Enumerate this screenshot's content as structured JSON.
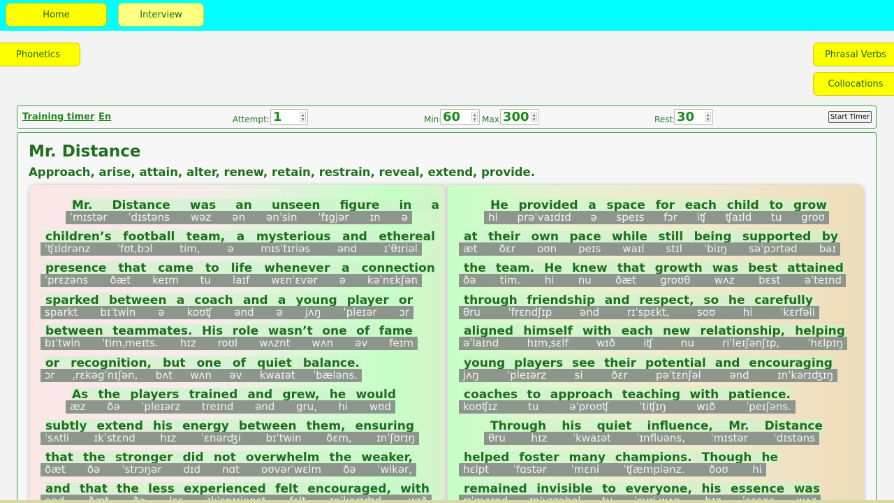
{
  "nav": {
    "home": "Home",
    "interview": "Interview",
    "phonetics": "Phonetics",
    "phrasal_verbs": "Phrasal Verbs",
    "collocations": "Collocations"
  },
  "timer": {
    "training_timer": "Training timer",
    "lang": "En",
    "attempt_label": "Attempt:",
    "attempt_value": "1",
    "min_label": "Min:",
    "min_value": "60",
    "max_label": "Max:",
    "max_value": "300",
    "rest_label": "Rest:",
    "rest_value": "30",
    "start_button": "Start Timer"
  },
  "story": {
    "title": "Mr. Distance",
    "subtitle": "Approach, arise, attain, alter, renew, retain, restrain, reveal, extend, provide."
  },
  "left_lines": [
    {
      "words": [
        "Mr.",
        "Distance",
        "was",
        "an",
        "unseen",
        "figure",
        "in",
        "a"
      ],
      "ipa": [
        "ˈmɪstər",
        "ˈdɪstəns",
        "wəz",
        "ən",
        "ənˈsin",
        "ˈfɪgjər",
        "ɪn",
        "ə"
      ]
    },
    {
      "words": [
        "children’s",
        "football",
        "team,",
        "a",
        "mysterious",
        "and",
        "ethereal"
      ],
      "ipa": [
        "ˈʧɪldrənz",
        "ˈfʊtˌbɔl",
        "tim,",
        "ə",
        "mɪsˈtɪriəs",
        "ənd",
        "ɪˈθɪriəl"
      ]
    },
    {
      "words": [
        "presence",
        "that",
        "came",
        "to",
        "life",
        "whenever",
        "a",
        "connection"
      ],
      "ipa": [
        "ˈprɛzəns",
        "ðæt",
        "keɪm",
        "tu",
        "laɪf",
        "wɛnˈɛvər",
        "ə",
        "kəˈnɛkʃən"
      ]
    },
    {
      "words": [
        "sparked",
        "between",
        "a",
        "coach",
        "and",
        "a",
        "young",
        "player",
        "or"
      ],
      "ipa": [
        "sparkt",
        "bɪˈtwin",
        "ə",
        "koʊʧ",
        "ənd",
        "ə",
        "jʌŋ",
        "ˈpleɪər",
        "ɔr"
      ]
    },
    {
      "words": [
        "between",
        "teammates.",
        "His",
        "role",
        "wasn’t",
        "one",
        "of",
        "fame"
      ],
      "ipa": [
        "bɪˈtwin",
        "ˈtimˌmeɪts.",
        "hɪz",
        "roʊl",
        "wʌznt",
        "wʌn",
        "əv",
        "feɪm"
      ]
    },
    {
      "words": [
        "or",
        "recognition,",
        "but",
        "one",
        "of",
        "quiet",
        "balance."
      ],
      "ipa": [
        "ɔr",
        "ˌrɛkəgˈnɪʃən,",
        "bʌt",
        "wʌn",
        "əv",
        "kwaɪət",
        "ˈbæləns."
      ]
    },
    {
      "words": [
        "As",
        "the",
        "players",
        "trained",
        "and",
        "grew,",
        "he",
        "would"
      ],
      "ipa": [
        "æz",
        "ðə",
        "ˈpleɪərz",
        "treɪnd",
        "ənd",
        "gru,",
        "hi",
        "wʊd"
      ]
    },
    {
      "words": [
        "subtly",
        "extend",
        "his",
        "energy",
        "between",
        "them,",
        "ensuring"
      ],
      "ipa": [
        "ˈsʌtli",
        "ɪkˈstɛnd",
        "hɪz",
        "ˈɛnərʤi",
        "bɪˈtwin",
        "ðɛm,",
        "ɪnˈʃʊrɪŋ"
      ]
    },
    {
      "words": [
        "that",
        "the",
        "stronger",
        "did",
        "not",
        "overwhelm",
        "the",
        "weaker,"
      ],
      "ipa": [
        "ðæt",
        "ðə",
        "ˈstrɔŋər",
        "dɪd",
        "nɑt",
        "oʊvərˈwɛlm",
        "ðə",
        "ˈwikər,"
      ]
    },
    {
      "words": [
        "and",
        "that",
        "the",
        "less",
        "experienced",
        "felt",
        "encouraged,",
        "with"
      ],
      "ipa": [
        "ənd",
        "ðæt",
        "ðə",
        "lɛs",
        "ɪkˈspɪriənst",
        "fɛlt",
        "ɪnˈkərɪʤd,",
        "wɪð"
      ]
    }
  ],
  "right_lines": [
    {
      "words": [
        "He",
        "provided",
        "a",
        "space",
        "for",
        "each",
        "child",
        "to",
        "grow"
      ],
      "ipa": [
        "hi",
        "prəˈvaɪdɪd",
        "ə",
        "speɪs",
        "fɔr",
        "iʧ",
        "ʧaɪld",
        "tu",
        "groʊ"
      ]
    },
    {
      "words": [
        "at",
        "their",
        "own",
        "pace",
        "while",
        "still",
        "being",
        "supported",
        "by"
      ],
      "ipa": [
        "æt",
        "ðɛr",
        "oʊn",
        "peɪs",
        "waɪl",
        "stɪl",
        "ˈbiɪŋ",
        "səˈpɔrtəd",
        "baɪ"
      ]
    },
    {
      "words": [
        "the",
        "team.",
        "He",
        "knew",
        "that",
        "growth",
        "was",
        "best",
        "attained"
      ],
      "ipa": [
        "ðə",
        "tim.",
        "hi",
        "nu",
        "ðæt",
        "groʊθ",
        "wʌz",
        "bɛst",
        "əˈteɪnd"
      ]
    },
    {
      "words": [
        "through",
        "friendship",
        "and",
        "respect,",
        "so",
        "he",
        "carefully"
      ],
      "ipa": [
        "θru",
        "ˈfrɛndʃɪp",
        "ənd",
        "rɪˈspɛkt,",
        "soʊ",
        "hi",
        "ˈkɛrfəli"
      ]
    },
    {
      "words": [
        "aligned",
        "himself",
        "with",
        "each",
        "new",
        "relationship,",
        "helping"
      ],
      "ipa": [
        "əˈlaɪnd",
        "hɪmˌsɛlf",
        "wɪð",
        "iʧ",
        "nu",
        "riˈleɪʃənʃɪp,",
        "ˈhɛlpɪŋ"
      ]
    },
    {
      "words": [
        "young",
        "players",
        "see",
        "their",
        "potential",
        "and",
        "encouraging"
      ],
      "ipa": [
        "jʌŋ",
        "ˈpleɪərz",
        "si",
        "ðɛr",
        "pəˈtɛnʃəl",
        "ənd",
        "ɪnˈkərɪʤɪŋ"
      ]
    },
    {
      "words": [
        "coaches",
        "to",
        "approach",
        "teaching",
        "with",
        "patience."
      ],
      "ipa": [
        "koʊʧɪz",
        "tu",
        "əˈproʊʧ",
        "ˈtiʧɪŋ",
        "wɪð",
        "ˈpeɪʃəns."
      ]
    },
    {
      "words": [
        "Through",
        "his",
        "quiet",
        "influence,",
        "Mr.",
        "Distance"
      ],
      "ipa": [
        "θru",
        "hɪz",
        "ˈkwaɪət",
        "ˈɪnfluəns,",
        "ˈmɪstər",
        "ˈdɪstəns"
      ]
    },
    {
      "words": [
        "helped",
        "foster",
        "many",
        "champions.",
        "Though",
        "he"
      ],
      "ipa": [
        "hɛlpt",
        "ˈfɑstər",
        "ˈmɛni",
        "ˈʧæmpiənz.",
        "ðoʊ",
        "hi"
      ]
    },
    {
      "words": [
        "remained",
        "invisible",
        "to",
        "everyone,",
        "his",
        "essence",
        "was"
      ],
      "ipa": [
        "rɪˈmeɪnd",
        "ɪnˈvɪzəbəl",
        "tu",
        "ˈɛvriˌwʌn,",
        "hɪz",
        "ˈɛsəns",
        "wʌz"
      ]
    }
  ]
}
